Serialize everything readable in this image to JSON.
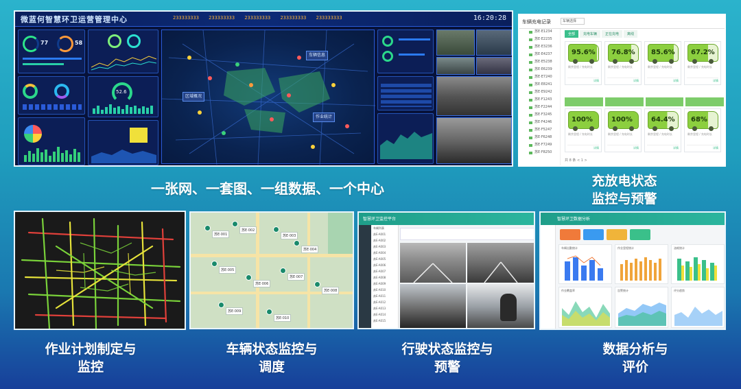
{
  "dashboard": {
    "title": "微蓝何智慧环卫运营管理中心",
    "clock": "16:20:28",
    "stats": [
      "233333333",
      "233333333",
      "233333333",
      "233333333",
      "233333333"
    ],
    "ring1": "77",
    "ring2": "58",
    "gauge": "52.6",
    "map_popups": [
      "区域概况",
      "车辆信息",
      "作业统计"
    ]
  },
  "charging": {
    "header_title": "车辆充电记录",
    "select_placeholder": "车辆选择",
    "tabs": [
      "全部",
      "充电车辆",
      "正在充电",
      "离线"
    ],
    "side_items": [
      "苏E·E1234",
      "苏E·E2235",
      "苏E·E3236",
      "苏E·E4237",
      "苏E·E5238",
      "苏E·E6239",
      "苏E·E7240",
      "苏E·E8241",
      "苏E·E9242",
      "苏E·F1243",
      "苏E·F2244",
      "苏E·F3245",
      "苏E·F4246",
      "苏E·F5247",
      "苏E·F6248",
      "苏E·F7249",
      "苏E·F8250"
    ],
    "cards_top": [
      {
        "pct": "95.6%",
        "level": 0.956
      },
      {
        "pct": "76.8%",
        "level": 0.768
      },
      {
        "pct": "85.6%",
        "level": 0.856
      },
      {
        "pct": "67.2%",
        "level": 0.672
      }
    ],
    "cards_bottom": [
      {
        "pct": "100%",
        "level": 1.0
      },
      {
        "pct": "100%",
        "level": 1.0
      },
      {
        "pct": "64.4%",
        "level": 0.644
      },
      {
        "pct": "68%",
        "level": 0.68
      }
    ],
    "card_meta": "剩余里程 / 充电时长",
    "card_foot": "详情",
    "pager": "共 8 条  < 1 >"
  },
  "captions": {
    "dashboard": "一张网、一套图、一组数据、一个中心",
    "charging_line1": "充放电状态",
    "charging_line2": "监控与预警",
    "plan_line1": "作业计划制定与",
    "plan_line2": "监控",
    "vehicle_line1": "车辆状态监控与",
    "vehicle_line2": "调度",
    "driving_line1": "行驶状态监控与",
    "driving_line2": "预警",
    "analysis_line1": "数据分析与",
    "analysis_line2": "评价"
  },
  "driving": {
    "title": "智慧环卫监控平台",
    "list": [
      "车辆列表",
      "苏E·A001",
      "苏E·A002",
      "苏E·A003",
      "苏E·A004",
      "苏E·A005",
      "苏E·A006",
      "苏E·A007",
      "苏E·A008",
      "苏E·A009",
      "苏E·A010",
      "苏E·A011",
      "苏E·A012",
      "苏E·A013",
      "苏E·A014",
      "苏E·A015"
    ]
  },
  "analytics": {
    "title": "智慧环卫数据分析",
    "cards": [
      "车辆出勤统计",
      "作业里程统计",
      "油耗统计",
      "作业覆盖率",
      "告警统计",
      "评分趋势"
    ]
  },
  "mapview": {
    "tags": [
      "苏E·001",
      "苏E·002",
      "苏E·003",
      "苏E·004",
      "苏E·005",
      "苏E·006",
      "苏E·007",
      "苏E·008",
      "苏E·009",
      "苏E·010"
    ]
  },
  "colors": {
    "background_top": "#2bb3cc",
    "background_bottom": "#173f9a",
    "accent_green": "#3bbf8c",
    "battery_green": "#8ccf3f"
  }
}
